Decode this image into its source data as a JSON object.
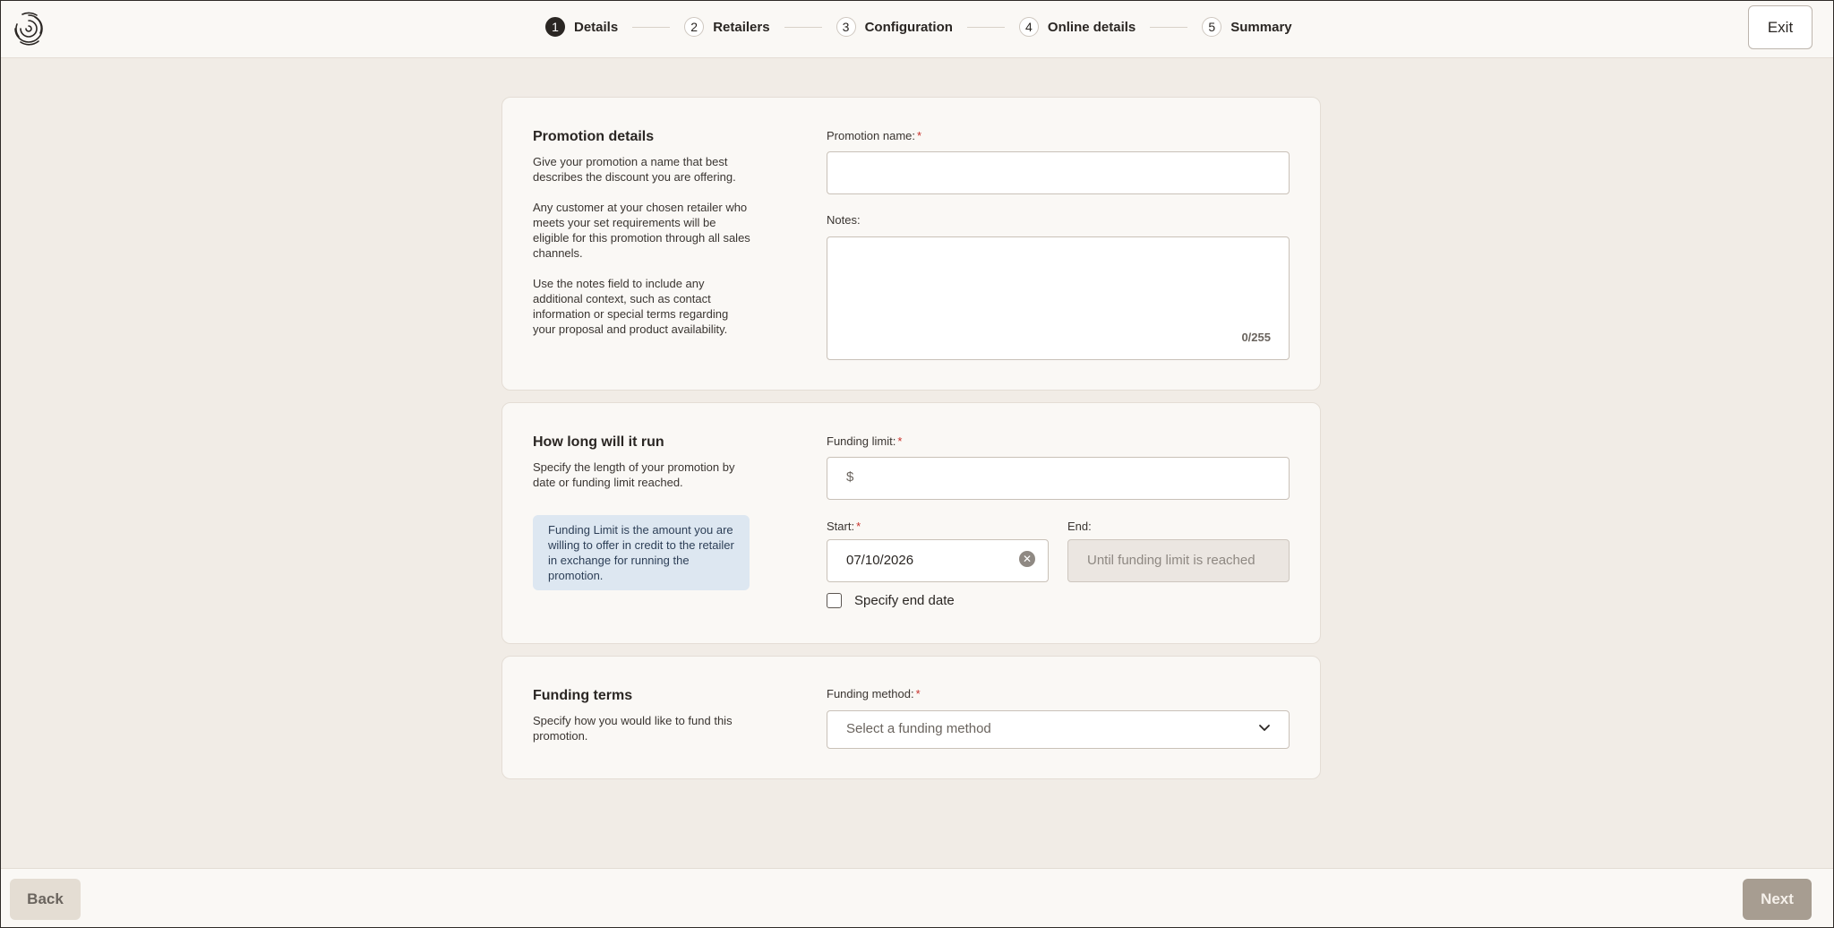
{
  "header": {
    "logo_icon": "spiral-logo-icon",
    "steps": [
      {
        "num": "1",
        "label": "Details"
      },
      {
        "num": "2",
        "label": "Retailers"
      },
      {
        "num": "3",
        "label": "Configuration"
      },
      {
        "num": "4",
        "label": "Online details"
      },
      {
        "num": "5",
        "label": "Summary"
      }
    ],
    "exit_label": "Exit"
  },
  "promotion_details": {
    "title": "Promotion details",
    "paragraphs": [
      "Give your promotion a name that best describes the discount you are offering.",
      "Any customer at your chosen retailer who meets your set requirements will be eligible for this promotion through all sales channels.",
      "Use the notes field to include any additional context, such as contact information or special terms regarding your proposal and product availability."
    ],
    "name_label": "Promotion name:",
    "name_value": "",
    "notes_label": "Notes:",
    "notes_value": "",
    "notes_counter": "0/255",
    "required_marker": "*"
  },
  "duration": {
    "title": "How long will it run",
    "description": "Specify the length of your promotion by date or funding limit reached.",
    "info": "Funding Limit is the amount you are willing to offer in credit to the retailer in exchange for running the promotion.",
    "funding_limit_label": "Funding limit:",
    "currency_symbol": "$",
    "start_label": "Start:",
    "start_value": "07/10/2026",
    "end_label": "End:",
    "end_placeholder": "Until funding limit is reached",
    "specify_end_label": "Specify end date",
    "specify_end_checked": false
  },
  "funding_terms": {
    "title": "Funding terms",
    "description": "Specify how you would like to fund this promotion.",
    "method_label": "Funding method:",
    "method_placeholder": "Select a funding method"
  },
  "footer": {
    "back_label": "Back",
    "next_label": "Next"
  },
  "colors": {
    "background": "#f1ece6",
    "panel": "#faf8f5",
    "required": "#c8302a",
    "info_bg": "#dde7f1",
    "next_button": "#a79d91"
  }
}
